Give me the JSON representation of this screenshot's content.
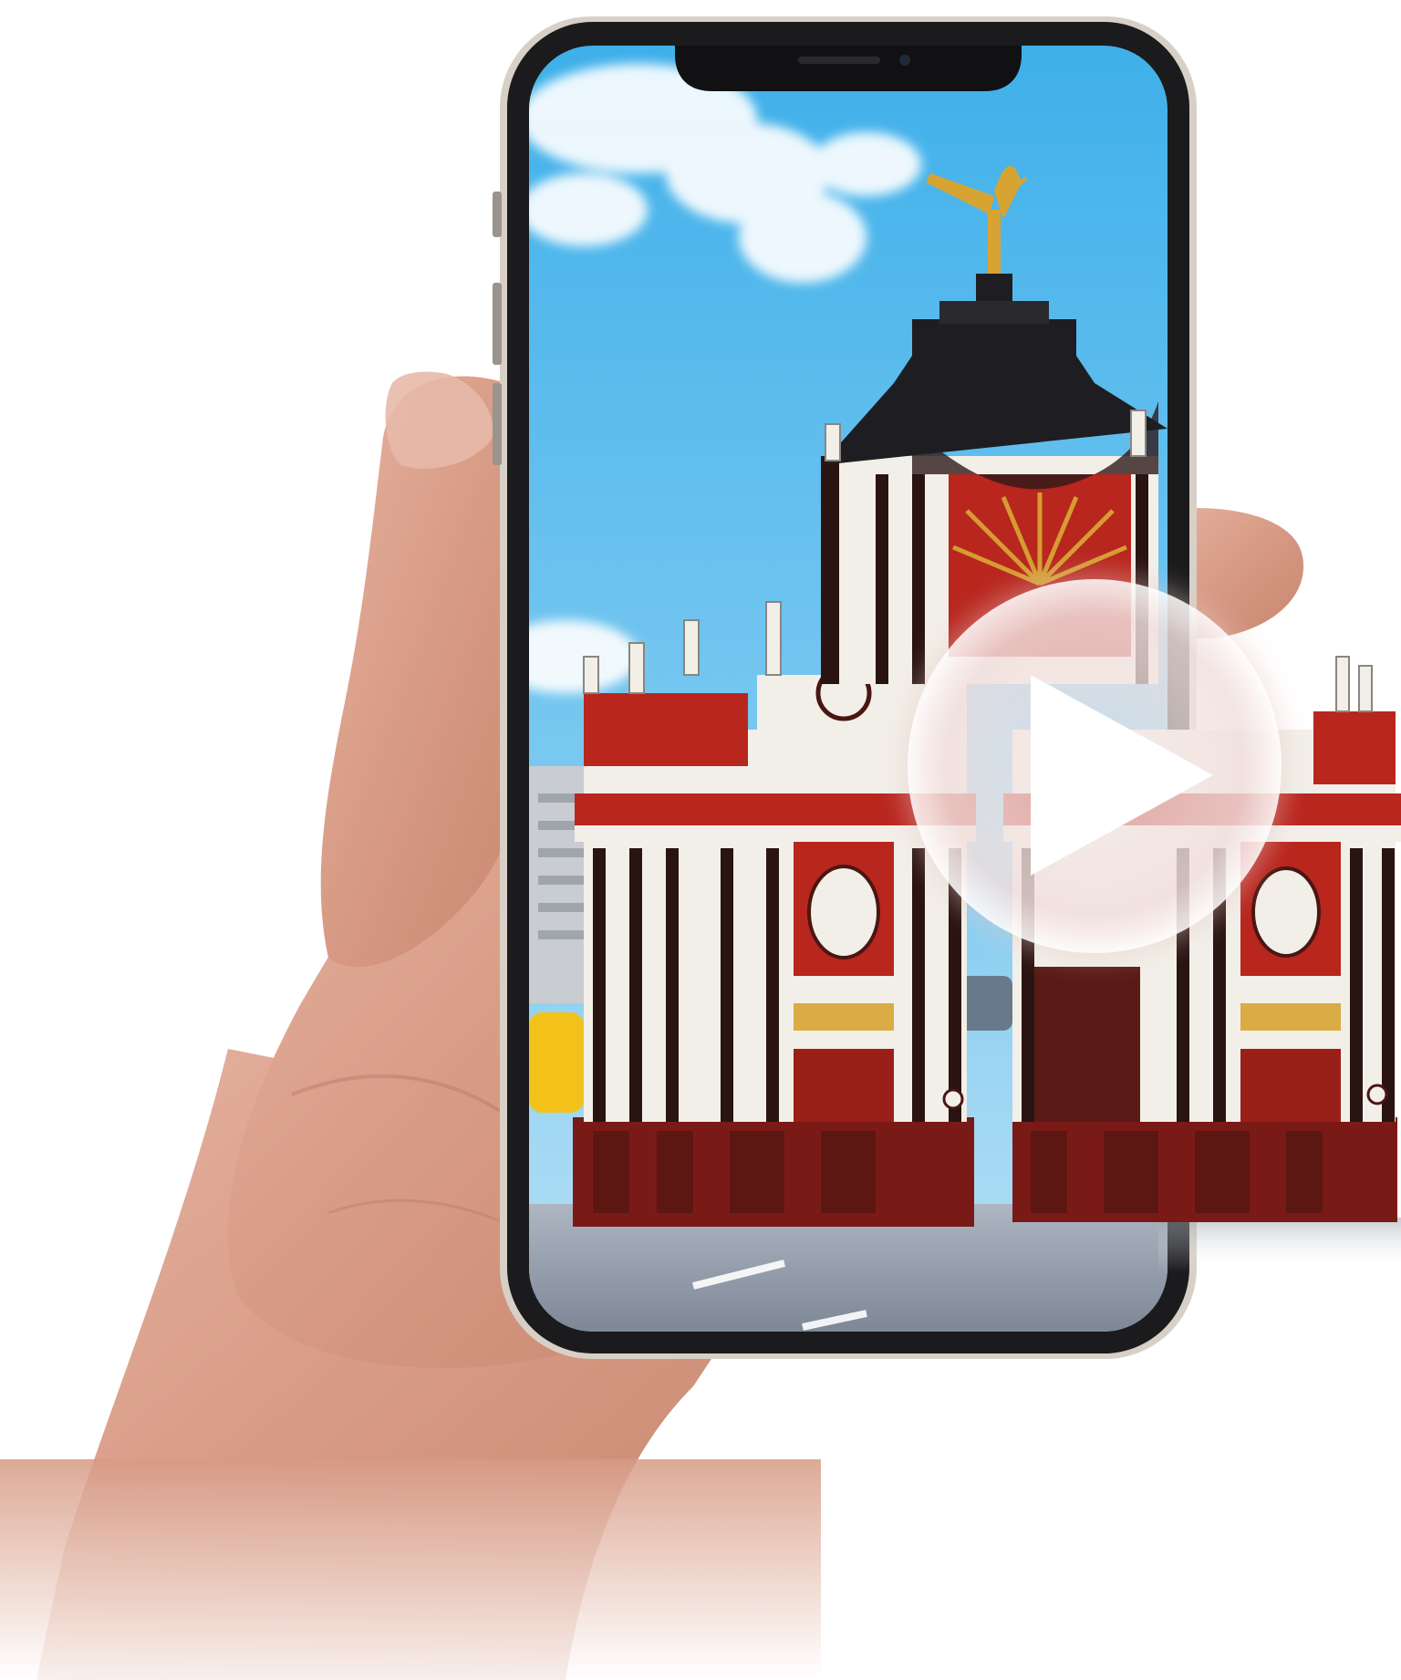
{
  "scene": {
    "subject": "hand-holding-smartphone",
    "screen_content": "red-baroque-triumphal-gate",
    "overlay_icon": "play-icon",
    "colors": {
      "background": "#ffffff",
      "sky_top": "#4fb6e8",
      "sky_bottom": "#a9dcf6",
      "gate_red": "#b8261e",
      "gate_white": "#f2efe8",
      "gate_dark": "#4a1612",
      "gold": "#d7a433",
      "road": "#9aa3b0",
      "skin": "#d8a08c",
      "skin_shadow": "#b77a66",
      "phone_frame": "#1b1b1d",
      "phone_rim": "#cfc7bd",
      "taxi": "#f2c21b",
      "play_button_fill": "rgba(255,255,255,0.55)",
      "play_triangle": "#ffffff"
    }
  }
}
